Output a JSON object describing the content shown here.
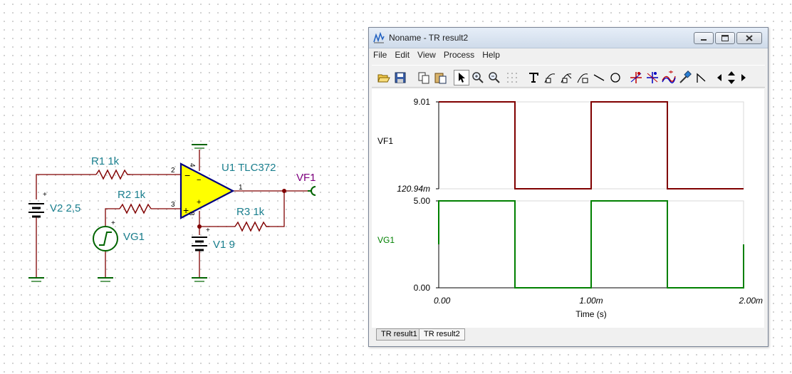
{
  "schematic": {
    "components": {
      "r1": "R1 1k",
      "r2": "R2 1k",
      "r3": "R3 1k",
      "opamp": "U1 TLC372",
      "v2": "V2 2,5",
      "vg1": "VG1",
      "v1": "V1 9",
      "vf1": "VF1"
    },
    "pins": {
      "inv": "2",
      "noninv": "3",
      "out": "1",
      "vplus": "4",
      "vminus": "8"
    },
    "signs": {
      "minus": "−",
      "plus": "+"
    },
    "wire_color": "#800000",
    "part_color": "#1a7f8e",
    "opamp_fill": "#ffff00"
  },
  "window": {
    "title": "Noname - TR result2",
    "menu": [
      "File",
      "Edit",
      "View",
      "Process",
      "Help"
    ],
    "toolbar_icons": [
      "open-icon",
      "save-icon",
      "copy-icon",
      "paste-icon",
      "select-pointer-icon",
      "zoom-in-icon",
      "zoom-100-icon",
      "grid-icon",
      "text-icon",
      "curve-label-icon",
      "curve-label2-icon",
      "curve-label3-icon",
      "line-icon",
      "circle-icon",
      "cursor-a-icon",
      "cursor-b-icon",
      "curves-icon",
      "probe-icon",
      "step-icon",
      "scroll-left-icon",
      "scroll-updown-icon",
      "scroll-right-icon"
    ],
    "tabs": [
      "TR result1",
      "TR result2"
    ],
    "active_tab": "TR result2"
  },
  "chart_data": [
    {
      "type": "line",
      "name": "VF1",
      "ylabel": "VF1",
      "yticks": [
        "9.01",
        "120.94m"
      ],
      "ylim": [
        0.12094,
        9.01
      ],
      "x": [
        0,
        0.0005,
        0.0005,
        0.001,
        0.001,
        0.0015,
        0.0015,
        0.002
      ],
      "y": [
        9.01,
        9.01,
        0.12094,
        0.12094,
        9.01,
        9.01,
        0.12094,
        0.12094
      ],
      "color": "#800000",
      "grid": true
    },
    {
      "type": "line",
      "name": "VG1",
      "ylabel": "VG1",
      "yticks": [
        "5.00",
        "0.00"
      ],
      "ylim": [
        0,
        5
      ],
      "x": [
        0,
        0,
        0.0005,
        0.0005,
        0.001,
        0.001,
        0.0015,
        0.0015,
        0.002,
        0.002
      ],
      "y": [
        2.5,
        5,
        5,
        0,
        0,
        5,
        5,
        0,
        0,
        2.5
      ],
      "color": "#008000",
      "xlabel": "Time (s)",
      "xticks": [
        "0.00",
        "1.00m",
        "2.00m"
      ],
      "xlim": [
        0,
        0.002
      ],
      "grid": true
    }
  ]
}
